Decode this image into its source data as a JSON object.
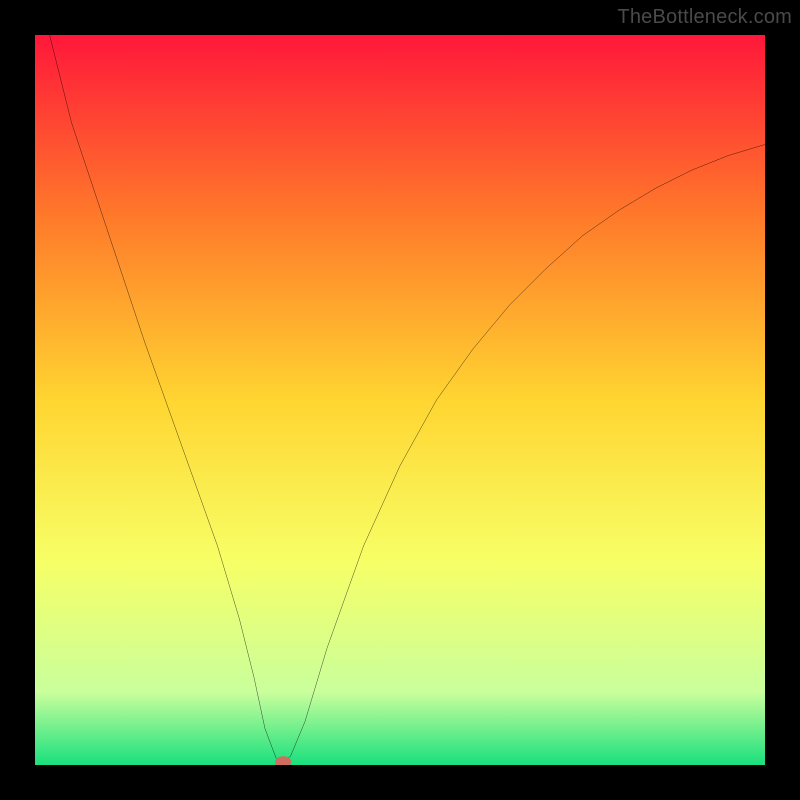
{
  "watermark": "TheBottleneck.com",
  "chart_data": {
    "type": "line",
    "title": "",
    "xlabel": "",
    "ylabel": "",
    "xlim": [
      0,
      100
    ],
    "ylim": [
      0,
      100
    ],
    "grid": false,
    "background_gradient": {
      "top": "#ff173a",
      "mid_upper": "#ff7a2a",
      "mid": "#ffd531",
      "mid_lower": "#f7ff66",
      "near_bottom": "#c9ff9c",
      "bottom": "#19e07e"
    },
    "series": [
      {
        "name": "bottleneck-curve",
        "color": "#000000",
        "x": [
          2,
          5,
          10,
          15,
          20,
          25,
          28,
          30,
          31.5,
          33,
          34,
          35,
          37,
          40,
          45,
          50,
          55,
          60,
          65,
          70,
          75,
          80,
          85,
          90,
          95,
          100
        ],
        "values": [
          100,
          88,
          73,
          58,
          44,
          30,
          20,
          12,
          5,
          1,
          0.4,
          1.2,
          6,
          16,
          30,
          41,
          50,
          57,
          63,
          68,
          72.5,
          76,
          79,
          81.5,
          83.5,
          85
        ]
      }
    ],
    "marker": {
      "name": "min-point",
      "x": 34,
      "y": 0.4,
      "color": "#cf6d61"
    }
  }
}
